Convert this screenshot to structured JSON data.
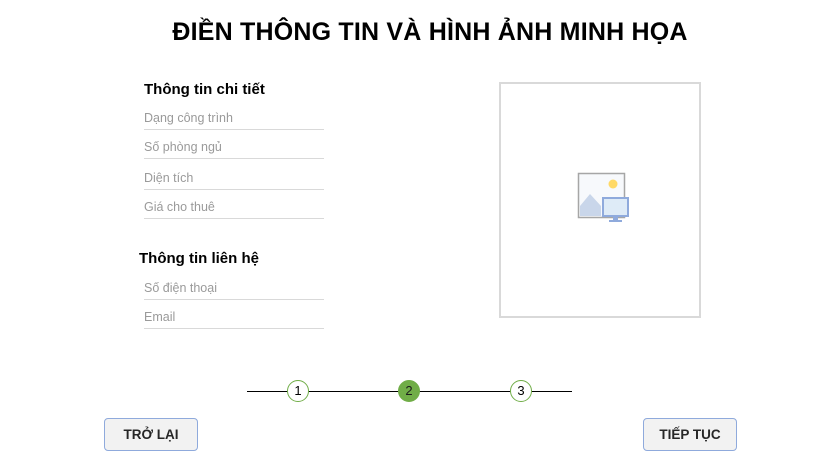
{
  "page": {
    "title": "ĐIỀN THÔNG TIN VÀ HÌNH ẢNH MINH HỌA"
  },
  "details": {
    "heading": "Thông tin chi tiết",
    "fields": [
      {
        "placeholder": "Dạng công trình",
        "value": ""
      },
      {
        "placeholder": "Số phòng ngủ",
        "value": ""
      },
      {
        "placeholder": "Diện tích",
        "value": ""
      },
      {
        "placeholder": "Giá cho thuê",
        "value": ""
      }
    ]
  },
  "contact": {
    "heading": "Thông tin liên hệ",
    "fields": [
      {
        "placeholder": "Số điện thoại",
        "value": ""
      },
      {
        "placeholder": "Email",
        "value": ""
      }
    ]
  },
  "image_upload": {
    "icon": "image-placeholder-icon"
  },
  "stepper": {
    "steps": [
      "1",
      "2",
      "3"
    ],
    "current_step": 2
  },
  "buttons": {
    "back_label": "TRỞ LẠI",
    "next_label": "TIẾP TỤC"
  },
  "colors": {
    "step_accent": "#70ad47",
    "button_border": "#8faadc",
    "button_bg": "#f2f2f2",
    "field_underline": "#d9d9d9",
    "image_border": "#d9d9d9"
  }
}
